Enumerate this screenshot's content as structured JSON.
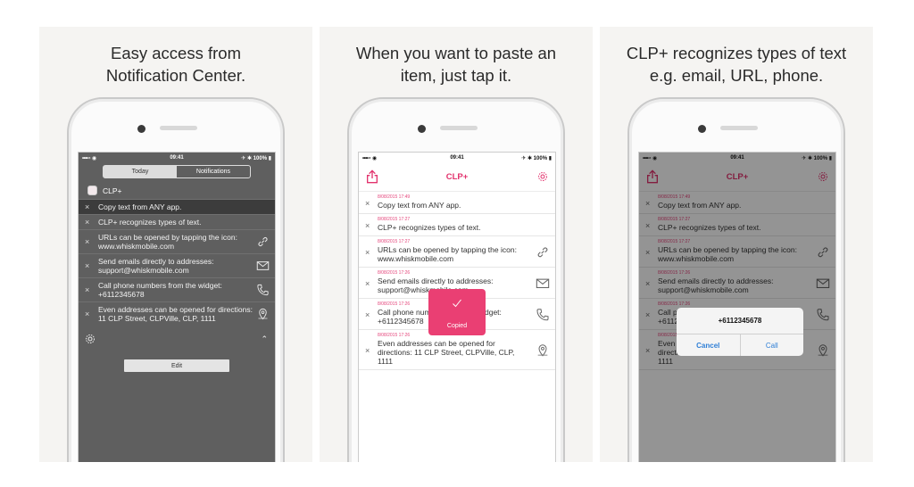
{
  "captions": [
    [
      "Easy access from",
      "Notification Center."
    ],
    [
      "When you want to paste an",
      "item, just tap it."
    ],
    [
      "CLP+ recognizes types of text",
      "e.g. email, URL, phone."
    ]
  ],
  "status": {
    "carrier": "••••∘ ◉",
    "time": "09:41",
    "battery": "✈ ✱ 100% ▮"
  },
  "nc": {
    "tabs": [
      "Today",
      "Notifications"
    ],
    "app_name": "CLP+",
    "items": [
      {
        "text": "Copy text from ANY app.",
        "icon": ""
      },
      {
        "text": "CLP+ recognizes types of text.",
        "icon": ""
      },
      {
        "text": "URLs can be opened by tapping the icon: www.whiskmobile.com",
        "icon": "link-icon"
      },
      {
        "text": "Send emails directly to addresses: support@whiskmobile.com",
        "icon": "mail-icon"
      },
      {
        "text": "Call phone numbers from the widget: +6112345678",
        "icon": "phone-icon"
      },
      {
        "text": "Even addresses can be opened for directions: 11 CLP Street, CLPVille, CLP, 1111",
        "icon": "map-pin-icon"
      }
    ],
    "edit_label": "Edit"
  },
  "app": {
    "title": "CLP+",
    "items": [
      {
        "time": "8/08/2015 17:49",
        "text": "Copy text from ANY app.",
        "icon": ""
      },
      {
        "time": "8/08/2015 17:27",
        "text": "CLP+ recognizes types of text.",
        "icon": ""
      },
      {
        "time": "8/08/2015 17:27",
        "text": "URLs can be opened by tapping the icon: www.whiskmobile.com",
        "icon": "link-icon"
      },
      {
        "time": "8/08/2015 17:26",
        "text": "Send emails directly to addresses: support@whiskmobile.com",
        "icon": "mail-icon"
      },
      {
        "time": "8/08/2015 17:26",
        "text": "Call phone numbers from the widget: +6112345678",
        "icon": "phone-icon"
      },
      {
        "time": "8/08/2015 17:26",
        "text": "Even addresses can be opened for directions: 11 CLP Street, CLPVille, CLP, 1111",
        "icon": "map-pin-icon"
      }
    ],
    "copied_label": "Copied",
    "alert": {
      "number": "+6112345678",
      "cancel": "Cancel",
      "call": "Call"
    }
  },
  "colors": {
    "accent": "#e2336d",
    "nc_bg": "#5f5f5f",
    "alert_blue": "#2f7fd6"
  }
}
